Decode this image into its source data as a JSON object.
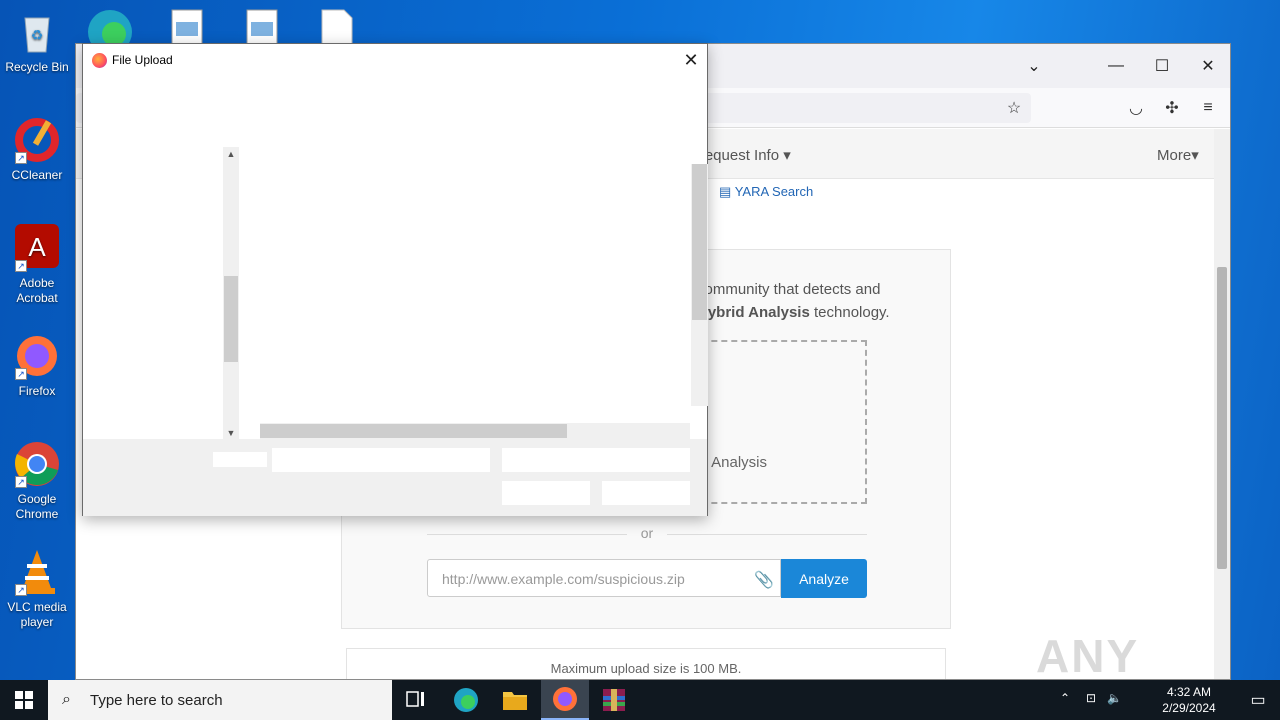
{
  "desktop": {
    "icons": [
      {
        "label": "Recycle Bin",
        "icon": "recycle-bin-icon"
      },
      {
        "label": "CCleaner",
        "icon": "ccleaner-icon"
      },
      {
        "label": "Adobe Acrobat",
        "icon": "acrobat-icon"
      },
      {
        "label": "Firefox",
        "icon": "firefox-icon"
      },
      {
        "label": "Google Chrome",
        "icon": "chrome-icon"
      },
      {
        "label": "VLC media player",
        "icon": "vlc-icon"
      }
    ]
  },
  "browser": {
    "site_nav": {
      "request_info": "Request Info",
      "more": "More"
    },
    "yara_link": "YARA Search",
    "intro_line1": "community that detects and",
    "intro_line2_bold": "Hybrid Analysis",
    "intro_line2_rest": " technology.",
    "drop_text": "Analysis",
    "or_text": "or",
    "url_placeholder": "http://www.example.com/suspicious.zip",
    "analyze_label": "Analyze",
    "max_upload": "Maximum upload size is 100 MB.",
    "watermark": "ANY RUN"
  },
  "dialog": {
    "title": "File Upload"
  },
  "taskbar": {
    "search_placeholder": "Type here to search",
    "time": "4:32 AM",
    "date": "2/29/2024"
  },
  "colors": {
    "desktop_blue": "#0a6fd6",
    "analyze_blue": "#1b87d8",
    "taskbar": "#101820"
  }
}
